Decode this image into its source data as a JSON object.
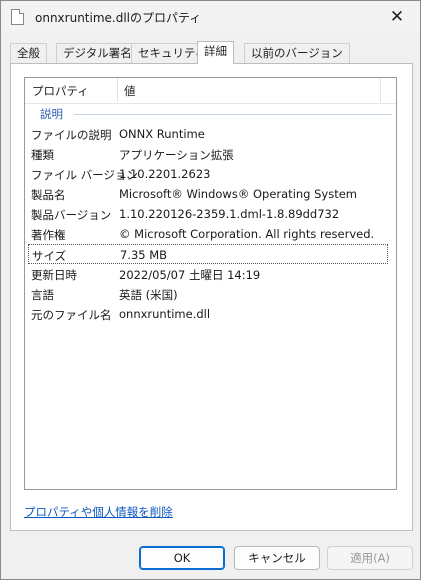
{
  "window": {
    "title": "onnxruntime.dllのプロパティ",
    "close_glyph": "✕"
  },
  "tabs": [
    {
      "label": "全般",
      "active": false
    },
    {
      "label": "デジタル署名",
      "active": false
    },
    {
      "label": "セキュリティ",
      "active": false
    },
    {
      "label": "詳細",
      "active": true
    },
    {
      "label": "以前のバージョン",
      "active": false
    }
  ],
  "details": {
    "headers": {
      "property": "プロパティ",
      "value": "値"
    },
    "group_label": "説明",
    "rows": [
      {
        "key": "ファイルの説明",
        "value": "ONNX Runtime"
      },
      {
        "key": "種類",
        "value": "アプリケーション拡張"
      },
      {
        "key": "ファイル バージョン",
        "value": "1.10.2201.2623"
      },
      {
        "key": "製品名",
        "value": "Microsoft® Windows® Operating System"
      },
      {
        "key": "製品バージョン",
        "value": "1.10.220126-2359.1.dml-1.8.89dd732"
      },
      {
        "key": "著作権",
        "value": "© Microsoft Corporation. All rights reserved."
      },
      {
        "key": "サイズ",
        "value": "7.35 MB"
      },
      {
        "key": "更新日時",
        "value": "2022/05/07 土曜日 14:19"
      },
      {
        "key": "言語",
        "value": "英語 (米国)"
      },
      {
        "key": "元のファイル名",
        "value": "onnxruntime.dll"
      }
    ]
  },
  "link_label": "プロパティや個人情報を削除",
  "buttons": {
    "ok": "OK",
    "cancel": "キャンセル",
    "apply": "適用(A)"
  }
}
